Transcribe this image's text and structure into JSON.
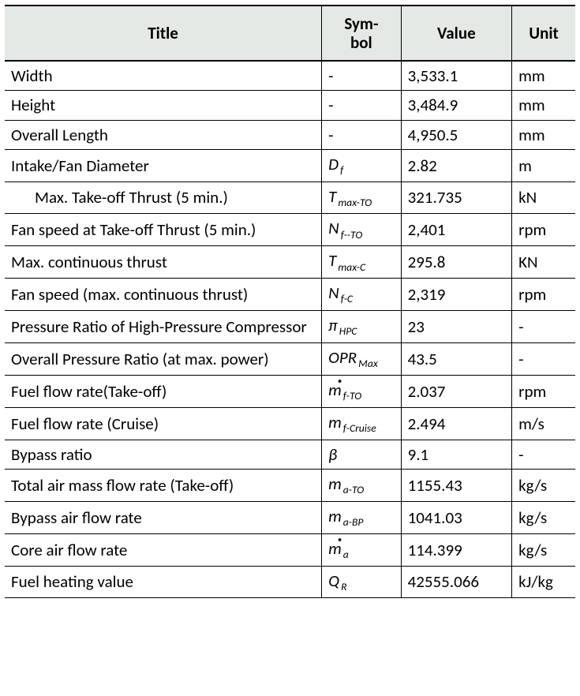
{
  "headers": {
    "title": "Title",
    "symbol": "Sym-\nbol",
    "value": "Value",
    "unit": "Unit"
  },
  "rows": [
    {
      "title": "Width",
      "sym_main": "-",
      "sym_sub": "",
      "value": "3,533.1",
      "unit": "mm",
      "dot": false
    },
    {
      "title": "Height",
      "sym_main": "-",
      "sym_sub": "",
      "value": "3,484.9",
      "unit": "mm",
      "dot": false
    },
    {
      "title": "Overall Length",
      "sym_main": "-",
      "sym_sub": "",
      "value": "4,950.5",
      "unit": "mm",
      "dot": false
    },
    {
      "title": "Intake/Fan Diameter",
      "sym_main": "D",
      "sym_sub": "f",
      "value": "2.82",
      "unit": "m",
      "dot": false
    },
    {
      "title": "Max. Take-off Thrust (5 min.)",
      "sym_main": "T",
      "sym_sub": "max-TO",
      "value": "321.735",
      "unit": "kN",
      "dot": false,
      "indent": true
    },
    {
      "title": "Fan speed at Take-off Thrust (5 min.)",
      "sym_main": "N",
      "sym_sub": "f--TO",
      "value": "2,401",
      "unit": "rpm",
      "dot": false
    },
    {
      "title": "Max. continuous thrust",
      "sym_main": "T",
      "sym_sub": "max-C",
      "value": "295.8",
      "unit": "KN",
      "dot": false
    },
    {
      "title": "Fan speed (max. continuous thrust)",
      "sym_main": "N",
      "sym_sub": "f-C",
      "value": "2,319",
      "unit": "rpm",
      "dot": false
    },
    {
      "title": "Pressure Ratio of High-Pressure Compressor",
      "sym_main": "π",
      "sym_sub": "HPC",
      "value": "23",
      "unit": "-",
      "dot": false
    },
    {
      "title": "Overall Pressure Ratio (at max. power)",
      "sym_main": "OPR",
      "sym_sub": "Max",
      "value": "43.5",
      "unit": "-",
      "dot": false
    },
    {
      "title": "Fuel flow rate(Take-off)",
      "sym_main": "m",
      "sym_sub": "f-TO",
      "value": "2.037",
      "unit": "rpm",
      "dot": true
    },
    {
      "title": "Fuel flow rate (Cruise)",
      "sym_main": "m",
      "sym_sub": "f-Cruise",
      "value": "2.494",
      "unit": "m/s",
      "dot": false
    },
    {
      "title": "Bypass ratio",
      "sym_main": "β",
      "sym_sub": "",
      "value": "9.1",
      "unit": "-",
      "dot": false
    },
    {
      "title": "Total air mass flow rate (Take-off)",
      "sym_main": "m",
      "sym_sub": "a-TO",
      "value": "1155.43",
      "unit": "kg/s",
      "dot": false
    },
    {
      "title": "Bypass air flow rate",
      "sym_main": "m",
      "sym_sub": "a-BP",
      "value": "1041.03",
      "unit": "kg/s",
      "dot": false
    },
    {
      "title": "Core air flow rate",
      "sym_main": "m",
      "sym_sub": "a",
      "value": "114.399",
      "unit": "kg/s",
      "dot": true
    },
    {
      "title": "Fuel heating value",
      "sym_main": "Q",
      "sym_sub": "R",
      "value": "42555.066",
      "unit": "kJ/kg",
      "dot": false
    }
  ],
  "chart_data": {
    "type": "table",
    "columns": [
      "Title",
      "Symbol",
      "Value",
      "Unit"
    ],
    "rows": [
      [
        "Width",
        "-",
        "3,533.1",
        "mm"
      ],
      [
        "Height",
        "-",
        "3,484.9",
        "mm"
      ],
      [
        "Overall Length",
        "-",
        "4,950.5",
        "mm"
      ],
      [
        "Intake/Fan Diameter",
        "D_f",
        "2.82",
        "m"
      ],
      [
        "Max. Take-off Thrust (5 min.)",
        "T_max-TO",
        "321.735",
        "kN"
      ],
      [
        "Fan speed at Take-off Thrust (5 min.)",
        "N_f--TO",
        "2,401",
        "rpm"
      ],
      [
        "Max. continuous thrust",
        "T_max-C",
        "295.8",
        "KN"
      ],
      [
        "Fan speed (max. continuous thrust)",
        "N_f-C",
        "2,319",
        "rpm"
      ],
      [
        "Pressure Ratio of High-Pressure Compressor",
        "π_HPC",
        "23",
        "-"
      ],
      [
        "Overall Pressure Ratio (at max. power)",
        "OPR_Max",
        "43.5",
        "-"
      ],
      [
        "Fuel flow rate(Take-off)",
        "ṁ_f-TO",
        "2.037",
        "rpm"
      ],
      [
        "Fuel flow rate (Cruise)",
        "m_f-Cruise",
        "2.494",
        "m/s"
      ],
      [
        "Bypass ratio",
        "β",
        "9.1",
        "-"
      ],
      [
        "Total air mass flow rate (Take-off)",
        "m_a-TO",
        "1155.43",
        "kg/s"
      ],
      [
        "Bypass air flow rate",
        "m_a-BP",
        "1041.03",
        "kg/s"
      ],
      [
        "Core air flow rate",
        "ṁ_a",
        "114.399",
        "kg/s"
      ],
      [
        "Fuel heating value",
        "Q_R",
        "42555.066",
        "kJ/kg"
      ]
    ]
  }
}
